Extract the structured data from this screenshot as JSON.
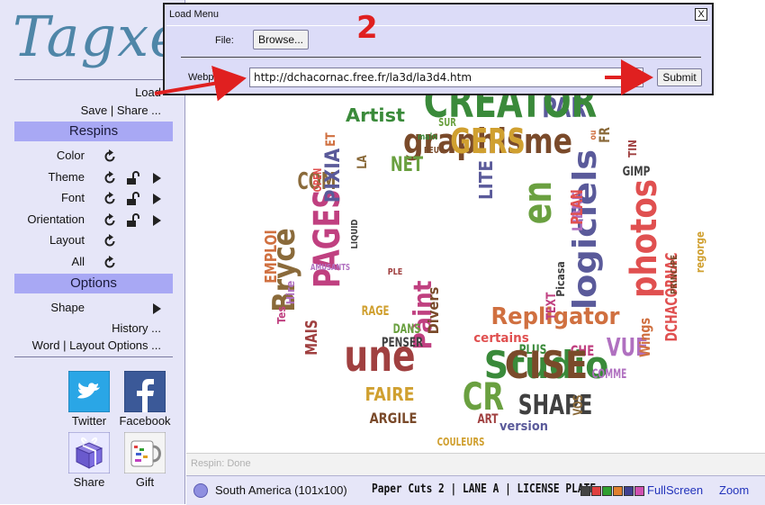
{
  "app": {
    "logo_text": "Tagxedo"
  },
  "sidebar": {
    "load_label": "Load",
    "save_share_label": "Save | Share ...",
    "respins_header": "Respins",
    "respins": [
      {
        "label": "Color",
        "respin": true,
        "lock": false,
        "submenu": false
      },
      {
        "label": "Theme",
        "respin": true,
        "lock": true,
        "submenu": true
      },
      {
        "label": "Font",
        "respin": true,
        "lock": true,
        "submenu": true
      },
      {
        "label": "Orientation",
        "respin": true,
        "lock": true,
        "submenu": true
      },
      {
        "label": "Layout",
        "respin": true,
        "lock": false,
        "submenu": false
      },
      {
        "label": "All",
        "respin": true,
        "lock": false,
        "submenu": false
      }
    ],
    "options_header": "Options",
    "shape_label": "Shape",
    "history_label": "History ...",
    "word_layout_label": "Word | Layout Options ...",
    "share_buttons": [
      {
        "label": "Twitter",
        "icon": "twitter-icon",
        "color": "#1da1f2"
      },
      {
        "label": "Facebook",
        "icon": "facebook-icon",
        "color": "#3b5998"
      },
      {
        "label": "Share",
        "icon": "gift-box-icon",
        "color": "#6a5acd"
      },
      {
        "label": "Gift",
        "icon": "mug-icon",
        "color": "#cccccc"
      }
    ]
  },
  "status": {
    "text": "Respin: Done"
  },
  "bottom_bar": {
    "shape": "South America (101x100)",
    "fonts": "Paper Cuts 2 | LANE A | LICENSE PLATE",
    "palette": [
      "#444444",
      "#e04040",
      "#30a030",
      "#e08030",
      "#404090",
      "#d050b0"
    ],
    "fullscreen_label": "FullScreen",
    "zoom_label": "Zoom"
  },
  "load_dialog": {
    "title": "Load Menu",
    "close_label": "X",
    "file_label": "File:",
    "browse_label": "Browse...",
    "webpage_label": "Webpage:",
    "url_value": "http://dchacornac.free.fr/la3d/la3d4.htm",
    "submit_label": "Submit"
  },
  "annotation": {
    "step_number": "2",
    "color": "#e02020"
  },
  "word_cloud": {
    "words": [
      "graphisme",
      "Studio",
      "PAGES",
      "photos",
      "logiciels",
      "Bryce",
      "Repligator",
      "une",
      "en",
      "SHAPE",
      "VUE",
      "FAIRE",
      "ARGILE",
      "Artist",
      "Pàint",
      "DCHACORNAC",
      "PAR",
      "COM",
      "EMPLOI",
      "MAIS",
      "NET",
      "GIMP",
      "COMME",
      "RAGE",
      "Divers",
      "PLUS",
      "CHE",
      "certains",
      "version",
      "VOS",
      "Wings",
      "ART",
      "CR",
      "Picasa",
      "LIBRE",
      "regorge",
      "PRINCIPE",
      "CREATOR",
      "Tes",
      "OPEN",
      "PIXIA",
      "LA",
      "ET",
      "PLE",
      "DANS",
      "PENSER",
      "AMUSANTS",
      "COULEURS",
      "PEUT",
      "main",
      "TEXT",
      "PLAN",
      "LITE",
      "FR",
      "ou",
      "TIN",
      "SUR",
      "LIQUID",
      "Hire",
      "GERS",
      "CISE"
    ]
  }
}
